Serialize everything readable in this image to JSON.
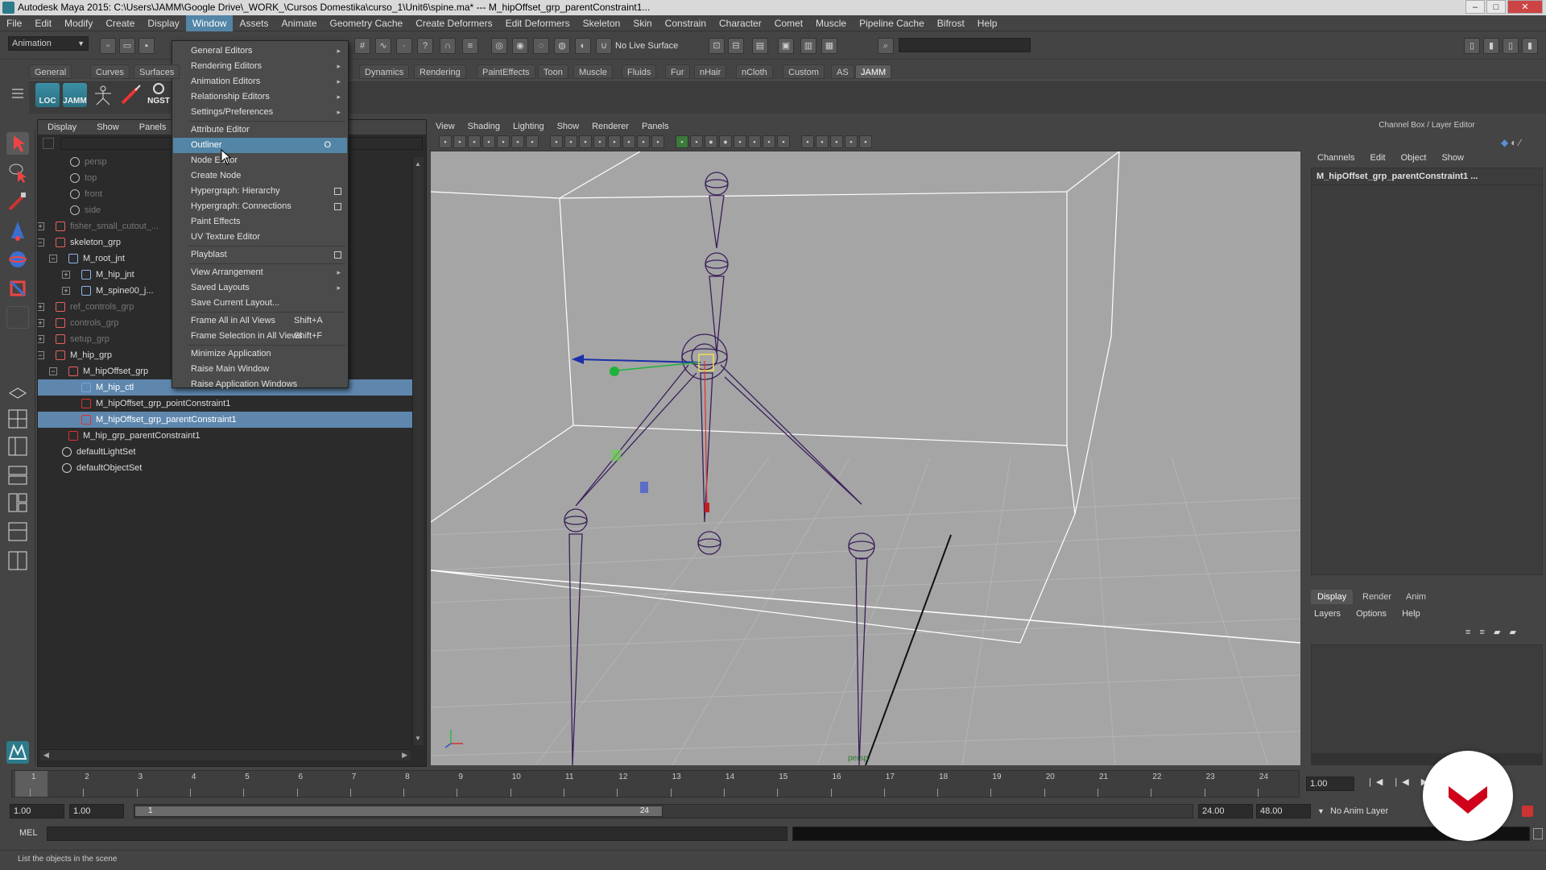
{
  "window": {
    "title": "Autodesk Maya 2015: C:\\Users\\JAMM\\Google Drive\\_WORK_\\Cursos Domestika\\curso_1\\Unit6\\spine.ma*   ---   M_hipOffset_grp_parentConstraint1...",
    "minimize": "–",
    "maximize": "□",
    "close": "✕"
  },
  "menubar": [
    "File",
    "Edit",
    "Modify",
    "Create",
    "Display",
    "Window",
    "Assets",
    "Animate",
    "Geometry Cache",
    "Create Deformers",
    "Edit Deformers",
    "Skeleton",
    "Skin",
    "Constrain",
    "Character",
    "Comet",
    "Muscle",
    "Pipeline Cache",
    "Bifrost",
    "Help"
  ],
  "statusline": {
    "mode": "Animation",
    "live_surface": "No Live Surface"
  },
  "shelf": {
    "tabs": [
      "General",
      "Curves",
      "Surfaces",
      "Dynamics",
      "Rendering",
      "PaintEffects",
      "Toon",
      "Muscle",
      "Fluids",
      "Fur",
      "nHair",
      "nCloth",
      "Custom",
      "AS",
      "JAMM"
    ],
    "selected_tab": "JAMM",
    "buttons": [
      "LOC",
      "JAMM",
      "",
      "",
      "NGST"
    ]
  },
  "outliner": {
    "menu": [
      "Display",
      "Show",
      "Panels"
    ],
    "rows": [
      {
        "label": "persp",
        "dim": true
      },
      {
        "label": "top",
        "dim": true
      },
      {
        "label": "front",
        "dim": true
      },
      {
        "label": "side",
        "dim": true
      },
      {
        "label": "fisher_small_cutout_...",
        "dim": true
      },
      {
        "label": "skeleton_grp"
      },
      {
        "label": "M_root_jnt"
      },
      {
        "label": "M_hip_jnt"
      },
      {
        "label": "M_spine00_j..."
      },
      {
        "label": "ref_controls_grp",
        "dim": true
      },
      {
        "label": "controls_grp",
        "dim": true
      },
      {
        "label": "setup_grp",
        "dim": true
      },
      {
        "label": "M_hip_grp"
      },
      {
        "label": "M_hipOffset_grp"
      },
      {
        "label": "M_hip_ctl"
      },
      {
        "label": "M_hipOffset_grp_pointConstraint1"
      },
      {
        "label": "M_hipOffset_grp_parentConstraint1"
      },
      {
        "label": "M_hip_grp_parentConstraint1"
      },
      {
        "label": "defaultLightSet"
      },
      {
        "label": "defaultObjectSet"
      }
    ]
  },
  "window_menu": {
    "items": [
      {
        "label": "General Editors",
        "submenu": true
      },
      {
        "label": "Rendering Editors",
        "submenu": true
      },
      {
        "label": "Animation Editors",
        "submenu": true
      },
      {
        "label": "Relationship Editors",
        "submenu": true
      },
      {
        "label": "Settings/Preferences",
        "submenu": true
      },
      {
        "label": "Attribute Editor"
      },
      {
        "label": "Outliner",
        "highlighted": true
      },
      {
        "label": "Node Editor"
      },
      {
        "label": "Create Node"
      },
      {
        "label": "Hypergraph: Hierarchy",
        "option": true
      },
      {
        "label": "Hypergraph: Connections",
        "option": true
      },
      {
        "label": "Paint Effects"
      },
      {
        "label": "UV Texture Editor"
      },
      {
        "label": "Playblast",
        "option": true
      },
      {
        "label": "View Arrangement",
        "submenu": true
      },
      {
        "label": "Saved Layouts",
        "submenu": true
      },
      {
        "label": "Save Current Layout..."
      },
      {
        "label": "Frame All in All Views",
        "shortcut": "Shift+A"
      },
      {
        "label": "Frame Selection in All Views",
        "shortcut": "Shift+F"
      },
      {
        "label": "Minimize Application"
      },
      {
        "label": "Raise Main Window"
      },
      {
        "label": "Raise Application Windows"
      }
    ]
  },
  "viewport": {
    "menu": [
      "View",
      "Shading",
      "Lighting",
      "Show",
      "Renderer",
      "Panels"
    ],
    "camera_label": "persp"
  },
  "channel_box": {
    "title": "Channel Box / Layer Editor",
    "menu": [
      "Channels",
      "Edit",
      "Object",
      "Show"
    ],
    "selected_node": "M_hipOffset_grp_parentConstraint1 ..."
  },
  "layer_editor": {
    "tabs": [
      "Display",
      "Render",
      "Anim"
    ],
    "menu": [
      "Layers",
      "Options",
      "Help"
    ]
  },
  "timeline": {
    "ticks": [
      "1",
      "2",
      "3",
      "4",
      "5",
      "6",
      "7",
      "8",
      "9",
      "10",
      "11",
      "12",
      "13",
      "14",
      "15",
      "16",
      "17",
      "18",
      "19",
      "20",
      "21",
      "22",
      "23",
      "24"
    ],
    "current_frame": "1.00"
  },
  "range": {
    "start": "1.00",
    "playback_start": "1.00",
    "range_start_label": "1",
    "range_end_label": "24",
    "playback_end": "24.00",
    "end": "48.00",
    "anim_layer": "No Anim Layer"
  },
  "command_line": {
    "lang": "MEL"
  },
  "help_line": "List the objects in the scene",
  "colors": {
    "highlight": "#5285a6",
    "selection": "#5f87ae",
    "viewport_bg": "#a5a5a5",
    "joint_wire": "#3a1e5a",
    "brand_red": "#d0021b"
  }
}
